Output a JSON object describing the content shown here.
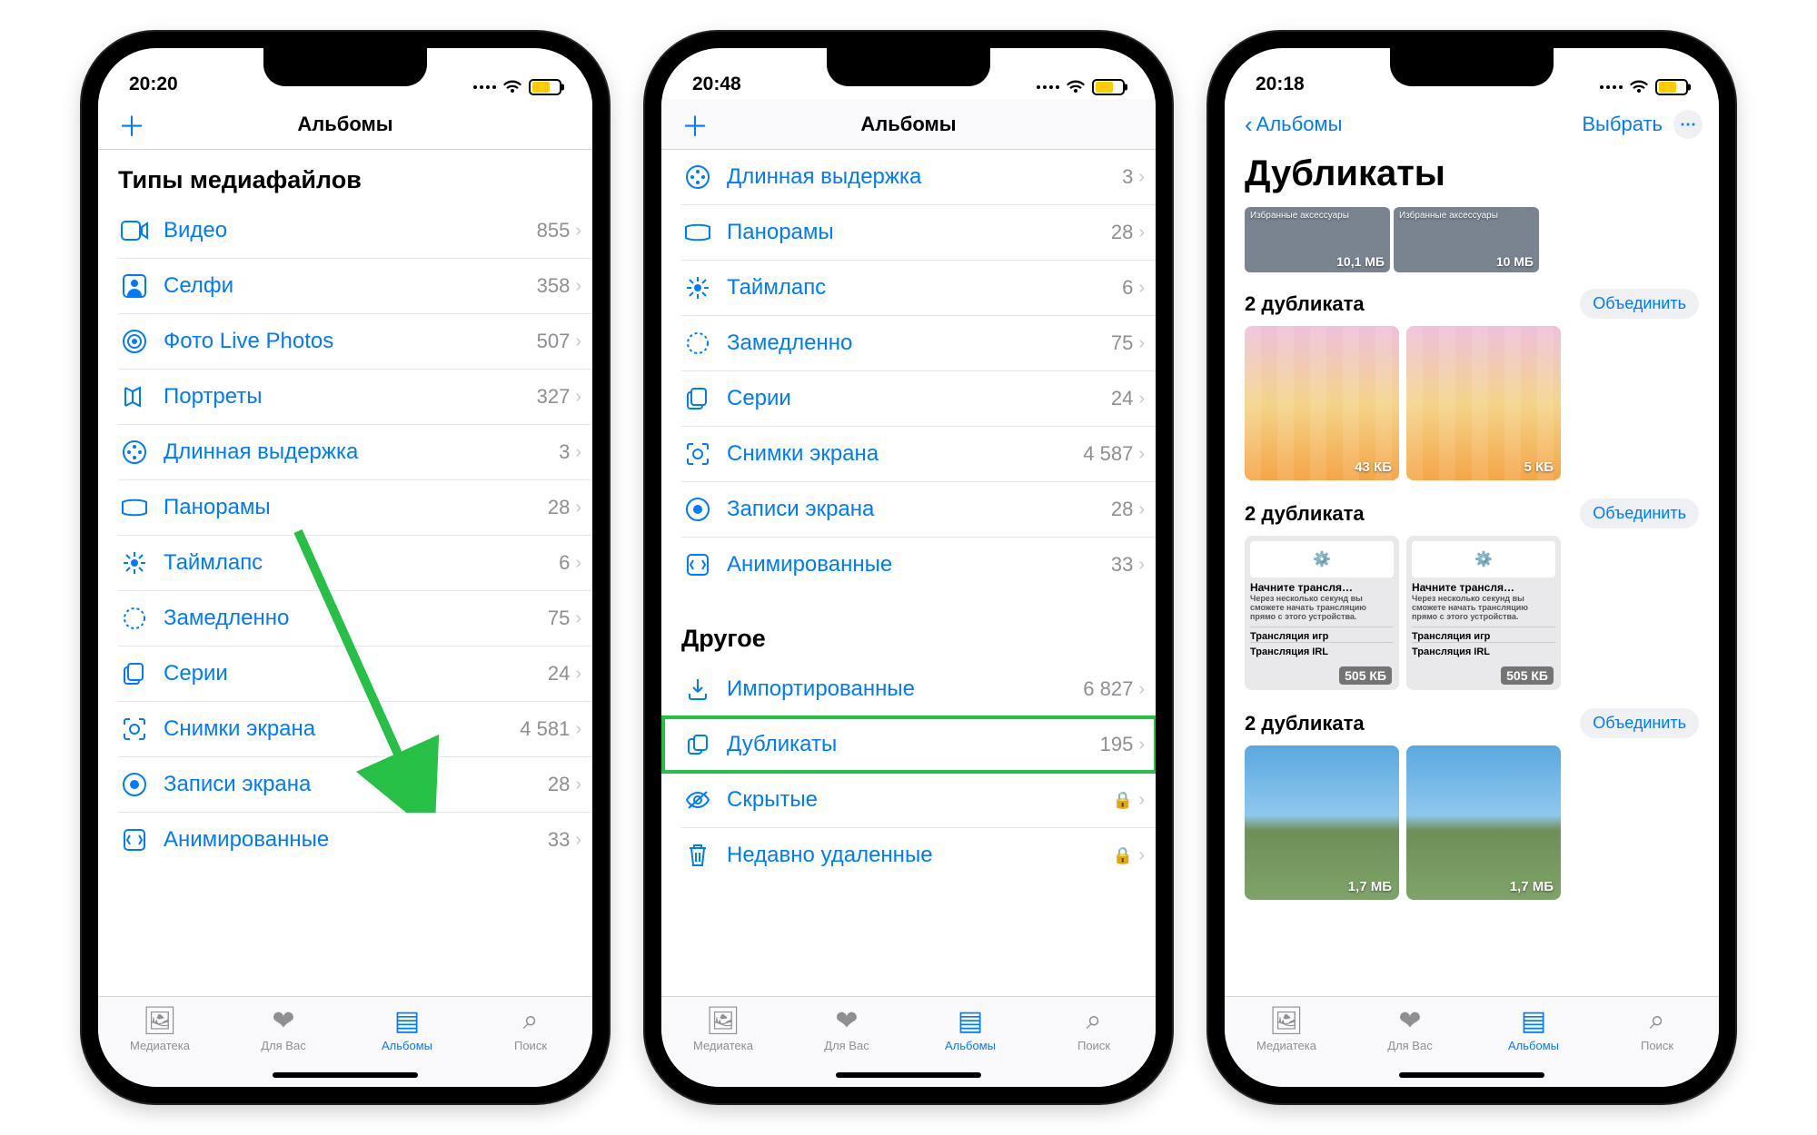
{
  "statusbar": {
    "time1": "20:20",
    "time2": "20:48",
    "time3": "20:18"
  },
  "nav": {
    "albums_title": "Альбомы",
    "back_albums": "Альбомы",
    "select": "Выбрать"
  },
  "phone1": {
    "section_title": "Типы медиафайлов",
    "items": [
      {
        "label": "Видео",
        "count": "855"
      },
      {
        "label": "Селфи",
        "count": "358"
      },
      {
        "label": "Фото Live Photos",
        "count": "507"
      },
      {
        "label": "Портреты",
        "count": "327"
      },
      {
        "label": "Длинная выдержка",
        "count": "3"
      },
      {
        "label": "Панорамы",
        "count": "28"
      },
      {
        "label": "Таймлапс",
        "count": "6"
      },
      {
        "label": "Замедленно",
        "count": "75"
      },
      {
        "label": "Серии",
        "count": "24"
      },
      {
        "label": "Снимки экрана",
        "count": "4 581"
      },
      {
        "label": "Записи экрана",
        "count": "28"
      },
      {
        "label": "Анимированные",
        "count": "33"
      }
    ]
  },
  "phone2": {
    "top_items": [
      {
        "label": "Длинная выдержка",
        "count": "3"
      },
      {
        "label": "Панорамы",
        "count": "28"
      },
      {
        "label": "Таймлапс",
        "count": "6"
      },
      {
        "label": "Замедленно",
        "count": "75"
      },
      {
        "label": "Серии",
        "count": "24"
      },
      {
        "label": "Снимки экрана",
        "count": "4 587"
      },
      {
        "label": "Записи экрана",
        "count": "28"
      },
      {
        "label": "Анимированные",
        "count": "33"
      }
    ],
    "other_title": "Другое",
    "other_items": [
      {
        "label": "Импортированные",
        "count": "6 827"
      },
      {
        "label": "Дубликаты",
        "count": "195",
        "highlight": true
      },
      {
        "label": "Скрытые",
        "locked": true
      },
      {
        "label": "Недавно удаленные",
        "locked": true
      }
    ]
  },
  "phone3": {
    "title": "Дубликаты",
    "strip": [
      {
        "size": "10,1 МБ",
        "caption": "Избранные аксессуары"
      },
      {
        "size": "10 МБ",
        "caption": "Избранные аксессуары"
      }
    ],
    "groups": [
      {
        "title": "2 дубликата",
        "merge": "Объединить",
        "thumbs": [
          {
            "size": "43 КБ",
            "type": "gradient"
          },
          {
            "size": "5 КБ",
            "type": "gradient"
          }
        ]
      },
      {
        "title": "2 дубликата",
        "merge": "Объединить",
        "thumbs": [
          {
            "size": "505 КБ",
            "type": "card",
            "line": "Начните трансля…",
            "sub": "Трансляция игр",
            "sub2": "Трансляция IRL"
          },
          {
            "size": "505 КБ",
            "type": "card",
            "line": "Начните трансля…",
            "sub": "Трансляция игр",
            "sub2": "Трансляция IRL"
          }
        ]
      },
      {
        "title": "2 дубликата",
        "merge": "Объединить",
        "thumbs": [
          {
            "size": "1,7 МБ",
            "type": "sky"
          },
          {
            "size": "1,7 МБ",
            "type": "sky"
          }
        ]
      }
    ]
  },
  "tabs": {
    "library": "Медиатека",
    "foryou": "Для Вас",
    "albums": "Альбомы",
    "search": "Поиск"
  }
}
